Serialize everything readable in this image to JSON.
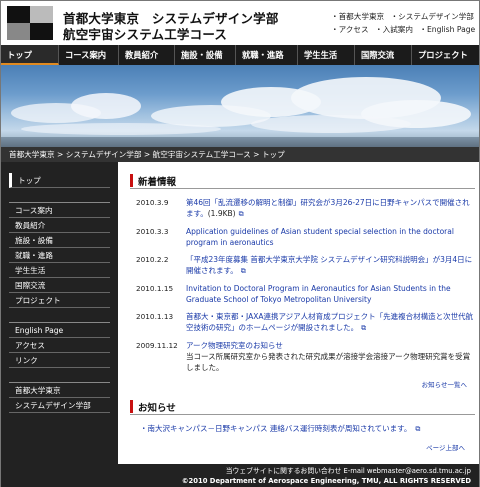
{
  "header": {
    "title_line1": "首都大学東京　システムデザイン学部",
    "title_line2": "航空宇宙システム工学コース",
    "util_links": [
      "・首都大学東京",
      "・システムデザイン学部",
      "・アクセス",
      "・入試案内",
      "・English Page"
    ]
  },
  "nav": {
    "items": [
      "トップ",
      "コース案内",
      "教員紹介",
      "施設・設備",
      "就職・進路",
      "学生生活",
      "国際交流",
      "プロジェクト"
    ]
  },
  "breadcrumb": "首都大学東京 > システムデザイン学部 > 航空宇宙システム工学コース > トップ",
  "sidebar": {
    "group1": [
      "トップ"
    ],
    "group2": [
      "コース案内",
      "教員紹介",
      "施設・設備",
      "就職・進路",
      "学生生活",
      "国際交流",
      "プロジェクト"
    ],
    "group3": [
      "English Page",
      "アクセス",
      "リンク"
    ],
    "group4": [
      "首都大学東京",
      "システムデザイン学部"
    ]
  },
  "news": {
    "heading": "新着情報",
    "items": [
      {
        "date": "2010.3.9",
        "text": "第46回「乱流遷移の解明と制御」研究会が3月26-27日に日野キャンパスで開催されます。",
        "size": "(1.9KB)"
      },
      {
        "date": "2010.3.3",
        "text": "Application guidelines of Asian student special selection in the doctoral program in aeronautics",
        "size": ""
      },
      {
        "date": "2010.2.2",
        "text": "「平成23年度募集 首都大学東京大学院 システムデザイン研究科説明会」が3月4日に開催されます。",
        "size": ""
      },
      {
        "date": "2010.1.15",
        "text": "Invitation to Doctoral Program in Aeronautics for Asian Students in the Graduate School of Tokyo Metropolitan University",
        "size": ""
      },
      {
        "date": "2010.1.13",
        "text": "首都大・東京都・JAXA連携アジア人材育成プロジェクト「先進複合材構造と次世代航空技術の研究」のホームページが開設されました。",
        "size": ""
      },
      {
        "date": "2009.11.12",
        "text": "アーク物理研究室のお知らせ",
        "sub": "当コース所属研究室から発表された研究成果が溶接学会溶接アーク物理研究賞を受賞しました。",
        "size": ""
      }
    ],
    "more": "お知らせ一覧へ"
  },
  "notices": {
    "heading": "お知らせ",
    "items": [
      "・南大沢キャンパス－日野キャンパス 連絡バス運行時刻表が周知されています。"
    ],
    "page_top": "ページ上部へ"
  },
  "footer": {
    "contact": "当ウェブサイトに関するお問い合わせ E-mail webmaster@aero.sd.tmu.ac.jp",
    "copyright": "©2010 Department of Aerospace Engineering, TMU, ALL RIGHTS RESERVED"
  },
  "colors": {
    "accent": "#c81010",
    "link": "#1a3aa8",
    "nav_bg": "#1b1b1b",
    "sidebar_bg": "#222222"
  }
}
